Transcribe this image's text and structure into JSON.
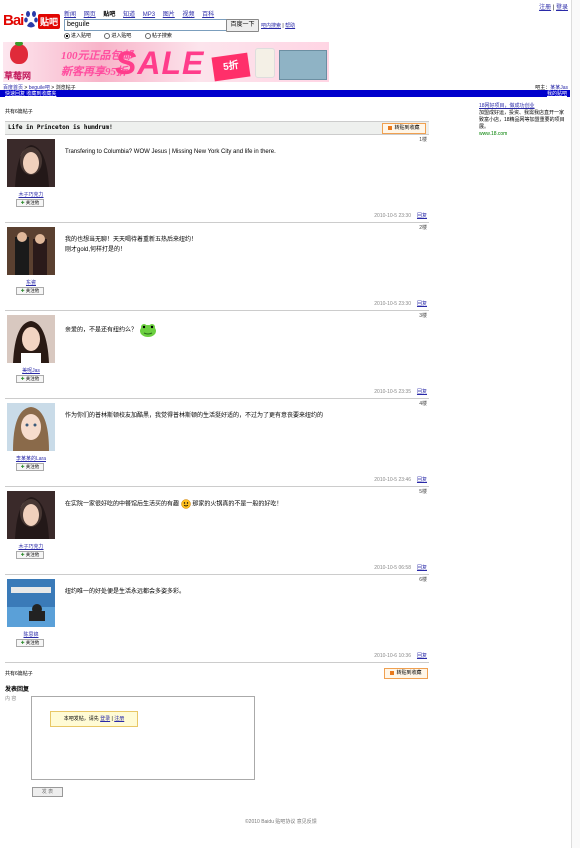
{
  "top_links": {
    "login": "登录",
    "register": "注册"
  },
  "logo": {
    "bai": "Bai",
    "tieba": "贴吧"
  },
  "nav": [
    "新闻",
    "网页",
    "贴吧",
    "知道",
    "MP3",
    "图片",
    "视频",
    "百科"
  ],
  "search": {
    "value": "beguile",
    "button": "百度一下",
    "link1": "吧内搜索",
    "link2": "帮助"
  },
  "radios": [
    {
      "label": "进入贴吧",
      "checked": true
    },
    {
      "label": "进入贴吧",
      "checked": false
    },
    {
      "label": "帖子搜索",
      "checked": false
    }
  ],
  "banner": {
    "brand": "草莓网",
    "line1": "100元正品包邮",
    "line2": "新客再享95折",
    "sale": "SALE",
    "tag": "5折"
  },
  "breadcrumb": {
    "home": "百度首页",
    "sep": ">",
    "forum": "beguile吧",
    "current": "浏览帖子"
  },
  "breadcrumb_right": {
    "prefix": "吧主：",
    "owner": "某某Jas"
  },
  "bluebar": {
    "left": "快速回复  收藏到收藏夹",
    "right": "我的贴吧"
  },
  "right_ad": {
    "title": "18网好项目，做成功创业",
    "body": "加盟成好运，投资、我需我店直开一家致富小店，18精品网等加盟重要的项目展。",
    "url": "www.18.com"
  },
  "thread": {
    "count_top": "共有6篇帖子",
    "count_bottom": "共有6篇帖子",
    "title": "Life in Princeton is humdrum!",
    "save_label": "转贴到收藏"
  },
  "posts": [
    {
      "floor": "1楼",
      "user": "木子巧克力",
      "follow": "关注他",
      "content": "Transfering to Columbia? WOW Jesus | Missing New York City and life in there.",
      "time": "2010-10-5 23:30",
      "reply": "回复"
    },
    {
      "floor": "2楼",
      "user": "东瓷",
      "follow": "关注他",
      "content": "我的也想当无聊！天天喝待着重新五热后来纽约！",
      "content2": "刚才gold,何样打是的！",
      "time": "2010-10-5 23:30",
      "reply": "回复"
    },
    {
      "floor": "3楼",
      "user": "美呢Jas",
      "follow": "关注他",
      "content": "亲爱的，不是还有纽约么？",
      "time": "2010-10-5 23:35",
      "reply": "回复"
    },
    {
      "floor": "4楼",
      "user": "李某某的Lara",
      "follow": "关注他",
      "content": "作为你们的普林斯顿校友加酷黑，我觉得普林斯顿的生活挺好适的，不过为了更有意丧要来纽约的",
      "time": "2010-10-5 23:46",
      "reply": "回复"
    },
    {
      "floor": "5楼",
      "user": "木子巧克力",
      "follow": "关注他",
      "content": "在实院一家很好吃的中餐馆后生活买的有趣",
      "content_tail": "那家的火锅真的不是一般的好吃！",
      "time": "2010-10-5 06:58",
      "reply": "回复"
    },
    {
      "floor": "6楼",
      "user": "陈思锦",
      "follow": "关注他",
      "content": "纽约唯一的好处便是生活永远都会多姿多彩。",
      "time": "2010-10-6 10:36",
      "reply": "回复"
    }
  ],
  "reply": {
    "heading": "发表回复",
    "content_label": "内  容",
    "notice": "本吧发帖，请先",
    "login": "登录",
    "sep": "|",
    "register": "注册",
    "submit": "发 表"
  },
  "footer": "©2010 Baidu 贴吧协议  意见反馈"
}
